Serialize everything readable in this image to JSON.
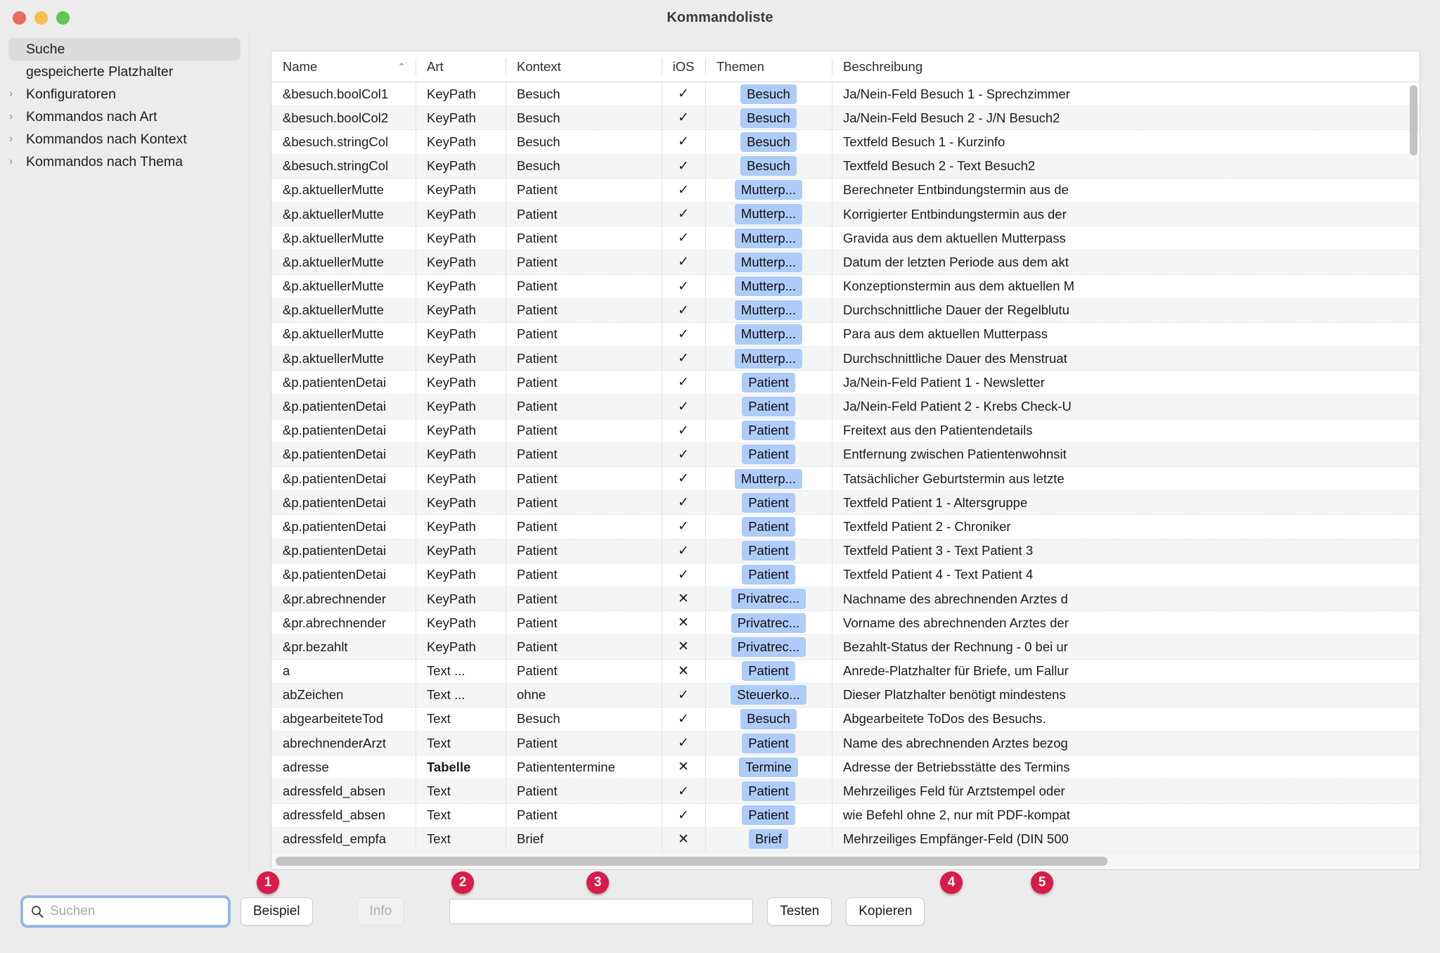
{
  "window": {
    "title": "Kommandoliste",
    "traffic_lights": [
      "close",
      "minimize",
      "zoom"
    ]
  },
  "sidebar": {
    "items": [
      {
        "label": "Suche",
        "selected": true,
        "expandable": false
      },
      {
        "label": "gespeicherte Platzhalter",
        "selected": false,
        "expandable": false
      },
      {
        "label": "Konfiguratoren",
        "selected": false,
        "expandable": true
      },
      {
        "label": "Kommandos nach Art",
        "selected": false,
        "expandable": true
      },
      {
        "label": "Kommandos nach Kontext",
        "selected": false,
        "expandable": true
      },
      {
        "label": "Kommandos nach Thema",
        "selected": false,
        "expandable": true
      }
    ]
  },
  "table": {
    "columns": [
      {
        "key": "name",
        "label": "Name",
        "sorted": "asc",
        "sort_glyph": "⌃"
      },
      {
        "key": "art",
        "label": "Art"
      },
      {
        "key": "kontext",
        "label": "Kontext"
      },
      {
        "key": "ios",
        "label": "iOS"
      },
      {
        "key": "themen",
        "label": "Themen"
      },
      {
        "key": "beschreibung",
        "label": "Beschreibung"
      }
    ],
    "badge_color": "#aecbfa",
    "check_glyph": "✓",
    "cross_glyph": "✕",
    "rows": [
      {
        "name": "&besuch.boolCol1",
        "art": "KeyPath",
        "kontext": "Besuch",
        "ios": true,
        "themen": "Besuch",
        "beschreibung": "Ja/Nein-Feld Besuch 1 - Sprechzimmer"
      },
      {
        "name": "&besuch.boolCol2",
        "art": "KeyPath",
        "kontext": "Besuch",
        "ios": true,
        "themen": "Besuch",
        "beschreibung": "Ja/Nein-Feld Besuch 2 - J/N Besuch2"
      },
      {
        "name": "&besuch.stringCol",
        "art": "KeyPath",
        "kontext": "Besuch",
        "ios": true,
        "themen": "Besuch",
        "beschreibung": "Textfeld Besuch 1 - Kurzinfo"
      },
      {
        "name": "&besuch.stringCol",
        "art": "KeyPath",
        "kontext": "Besuch",
        "ios": true,
        "themen": "Besuch",
        "beschreibung": "Textfeld Besuch 2 - Text Besuch2"
      },
      {
        "name": "&p.aktuellerMutte",
        "art": "KeyPath",
        "kontext": "Patient",
        "ios": true,
        "themen": "Mutterp...",
        "beschreibung": "Berechneter Entbindungstermin aus de"
      },
      {
        "name": "&p.aktuellerMutte",
        "art": "KeyPath",
        "kontext": "Patient",
        "ios": true,
        "themen": "Mutterp...",
        "beschreibung": "Korrigierter Entbindungstermin aus der"
      },
      {
        "name": "&p.aktuellerMutte",
        "art": "KeyPath",
        "kontext": "Patient",
        "ios": true,
        "themen": "Mutterp...",
        "beschreibung": "Gravida aus dem aktuellen Mutterpass"
      },
      {
        "name": "&p.aktuellerMutte",
        "art": "KeyPath",
        "kontext": "Patient",
        "ios": true,
        "themen": "Mutterp...",
        "beschreibung": "Datum der letzten Periode aus dem akt"
      },
      {
        "name": "&p.aktuellerMutte",
        "art": "KeyPath",
        "kontext": "Patient",
        "ios": true,
        "themen": "Mutterp...",
        "beschreibung": "Konzeptionstermin aus dem aktuellen M"
      },
      {
        "name": "&p.aktuellerMutte",
        "art": "KeyPath",
        "kontext": "Patient",
        "ios": true,
        "themen": "Mutterp...",
        "beschreibung": "Durchschnittliche Dauer der Regelblutu"
      },
      {
        "name": "&p.aktuellerMutte",
        "art": "KeyPath",
        "kontext": "Patient",
        "ios": true,
        "themen": "Mutterp...",
        "beschreibung": "Para aus dem aktuellen Mutterpass"
      },
      {
        "name": "&p.aktuellerMutte",
        "art": "KeyPath",
        "kontext": "Patient",
        "ios": true,
        "themen": "Mutterp...",
        "beschreibung": "Durchschnittliche Dauer des Menstruat"
      },
      {
        "name": "&p.patientenDetai",
        "art": "KeyPath",
        "kontext": "Patient",
        "ios": true,
        "themen": "Patient",
        "beschreibung": "Ja/Nein-Feld Patient 1 - Newsletter"
      },
      {
        "name": "&p.patientenDetai",
        "art": "KeyPath",
        "kontext": "Patient",
        "ios": true,
        "themen": "Patient",
        "beschreibung": "Ja/Nein-Feld Patient 2 - Krebs Check-U"
      },
      {
        "name": "&p.patientenDetai",
        "art": "KeyPath",
        "kontext": "Patient",
        "ios": true,
        "themen": "Patient",
        "beschreibung": "Freitext aus den Patientendetails"
      },
      {
        "name": "&p.patientenDetai",
        "art": "KeyPath",
        "kontext": "Patient",
        "ios": true,
        "themen": "Patient",
        "beschreibung": "Entfernung zwischen Patientenwohnsit"
      },
      {
        "name": "&p.patientenDetai",
        "art": "KeyPath",
        "kontext": "Patient",
        "ios": true,
        "themen": "Mutterp...",
        "beschreibung": "Tatsächlicher Geburtstermin aus letzte"
      },
      {
        "name": "&p.patientenDetai",
        "art": "KeyPath",
        "kontext": "Patient",
        "ios": true,
        "themen": "Patient",
        "beschreibung": "Textfeld Patient 1 - Altersgruppe"
      },
      {
        "name": "&p.patientenDetai",
        "art": "KeyPath",
        "kontext": "Patient",
        "ios": true,
        "themen": "Patient",
        "beschreibung": "Textfeld Patient 2 - Chroniker"
      },
      {
        "name": "&p.patientenDetai",
        "art": "KeyPath",
        "kontext": "Patient",
        "ios": true,
        "themen": "Patient",
        "beschreibung": "Textfeld Patient 3 - Text Patient 3"
      },
      {
        "name": "&p.patientenDetai",
        "art": "KeyPath",
        "kontext": "Patient",
        "ios": true,
        "themen": "Patient",
        "beschreibung": "Textfeld Patient 4 - Text Patient 4"
      },
      {
        "name": "&pr.abrechnender",
        "art": "KeyPath",
        "kontext": "Patient",
        "ios": false,
        "themen": "Privatrec...",
        "beschreibung": "Nachname des abrechnenden Arztes d"
      },
      {
        "name": "&pr.abrechnender",
        "art": "KeyPath",
        "kontext": "Patient",
        "ios": false,
        "themen": "Privatrec...",
        "beschreibung": "Vorname des abrechnenden Arztes der"
      },
      {
        "name": "&pr.bezahlt",
        "art": "KeyPath",
        "kontext": "Patient",
        "ios": false,
        "themen": "Privatrec...",
        "beschreibung": "Bezahlt-Status der Rechnung - 0 bei ur"
      },
      {
        "name": "a",
        "art": "Text ...",
        "kontext": "Patient",
        "ios": false,
        "themen": "Patient",
        "beschreibung": "Anrede-Platzhalter für Briefe, um Fallur"
      },
      {
        "name": "abZeichen",
        "art": "Text ...",
        "kontext": "ohne",
        "ios": true,
        "themen": "Steuerko...",
        "beschreibung": "Dieser Platzhalter benötigt mindestens"
      },
      {
        "name": "abgearbeiteteTod",
        "art": "Text",
        "kontext": "Besuch",
        "ios": true,
        "themen": "Besuch",
        "beschreibung": "Abgearbeitete ToDos des Besuchs."
      },
      {
        "name": "abrechnenderArzt",
        "art": "Text",
        "kontext": "Patient",
        "ios": true,
        "themen": "Patient",
        "beschreibung": "Name des abrechnenden Arztes bezog"
      },
      {
        "name": "adresse",
        "art": "Tabelle",
        "art_bold": true,
        "kontext": "Patiententermine",
        "ios": false,
        "themen": "Termine",
        "beschreibung": "Adresse der Betriebsstätte des Termins"
      },
      {
        "name": "adressfeld_absen",
        "art": "Text",
        "kontext": "Patient",
        "ios": true,
        "themen": "Patient",
        "beschreibung": "Mehrzeiliges Feld für Arztstempel oder"
      },
      {
        "name": "adressfeld_absen",
        "art": "Text",
        "kontext": "Patient",
        "ios": true,
        "themen": "Patient",
        "beschreibung": "wie Befehl ohne 2, nur mit PDF-kompat"
      },
      {
        "name": "adressfeld_empfa",
        "art": "Text",
        "kontext": "Brief",
        "ios": false,
        "themen": "Brief",
        "beschreibung": "Mehrzeiliges Empfänger-Feld (DIN 500"
      }
    ]
  },
  "toolbar": {
    "search_placeholder": "Suchen",
    "search_value": "",
    "beispiel_label": "Beispiel",
    "info_label": "Info",
    "info_disabled": true,
    "result_field_value": "",
    "testen_label": "Testen",
    "kopieren_label": "Kopieren"
  },
  "annotations": {
    "pin_color": "#d81c4a",
    "pins": [
      {
        "number": "1",
        "target": "search-input"
      },
      {
        "number": "2",
        "target": "beispiel-button"
      },
      {
        "number": "3",
        "target": "info-button"
      },
      {
        "number": "4",
        "target": "testen-button"
      },
      {
        "number": "5",
        "target": "kopieren-button"
      }
    ]
  }
}
